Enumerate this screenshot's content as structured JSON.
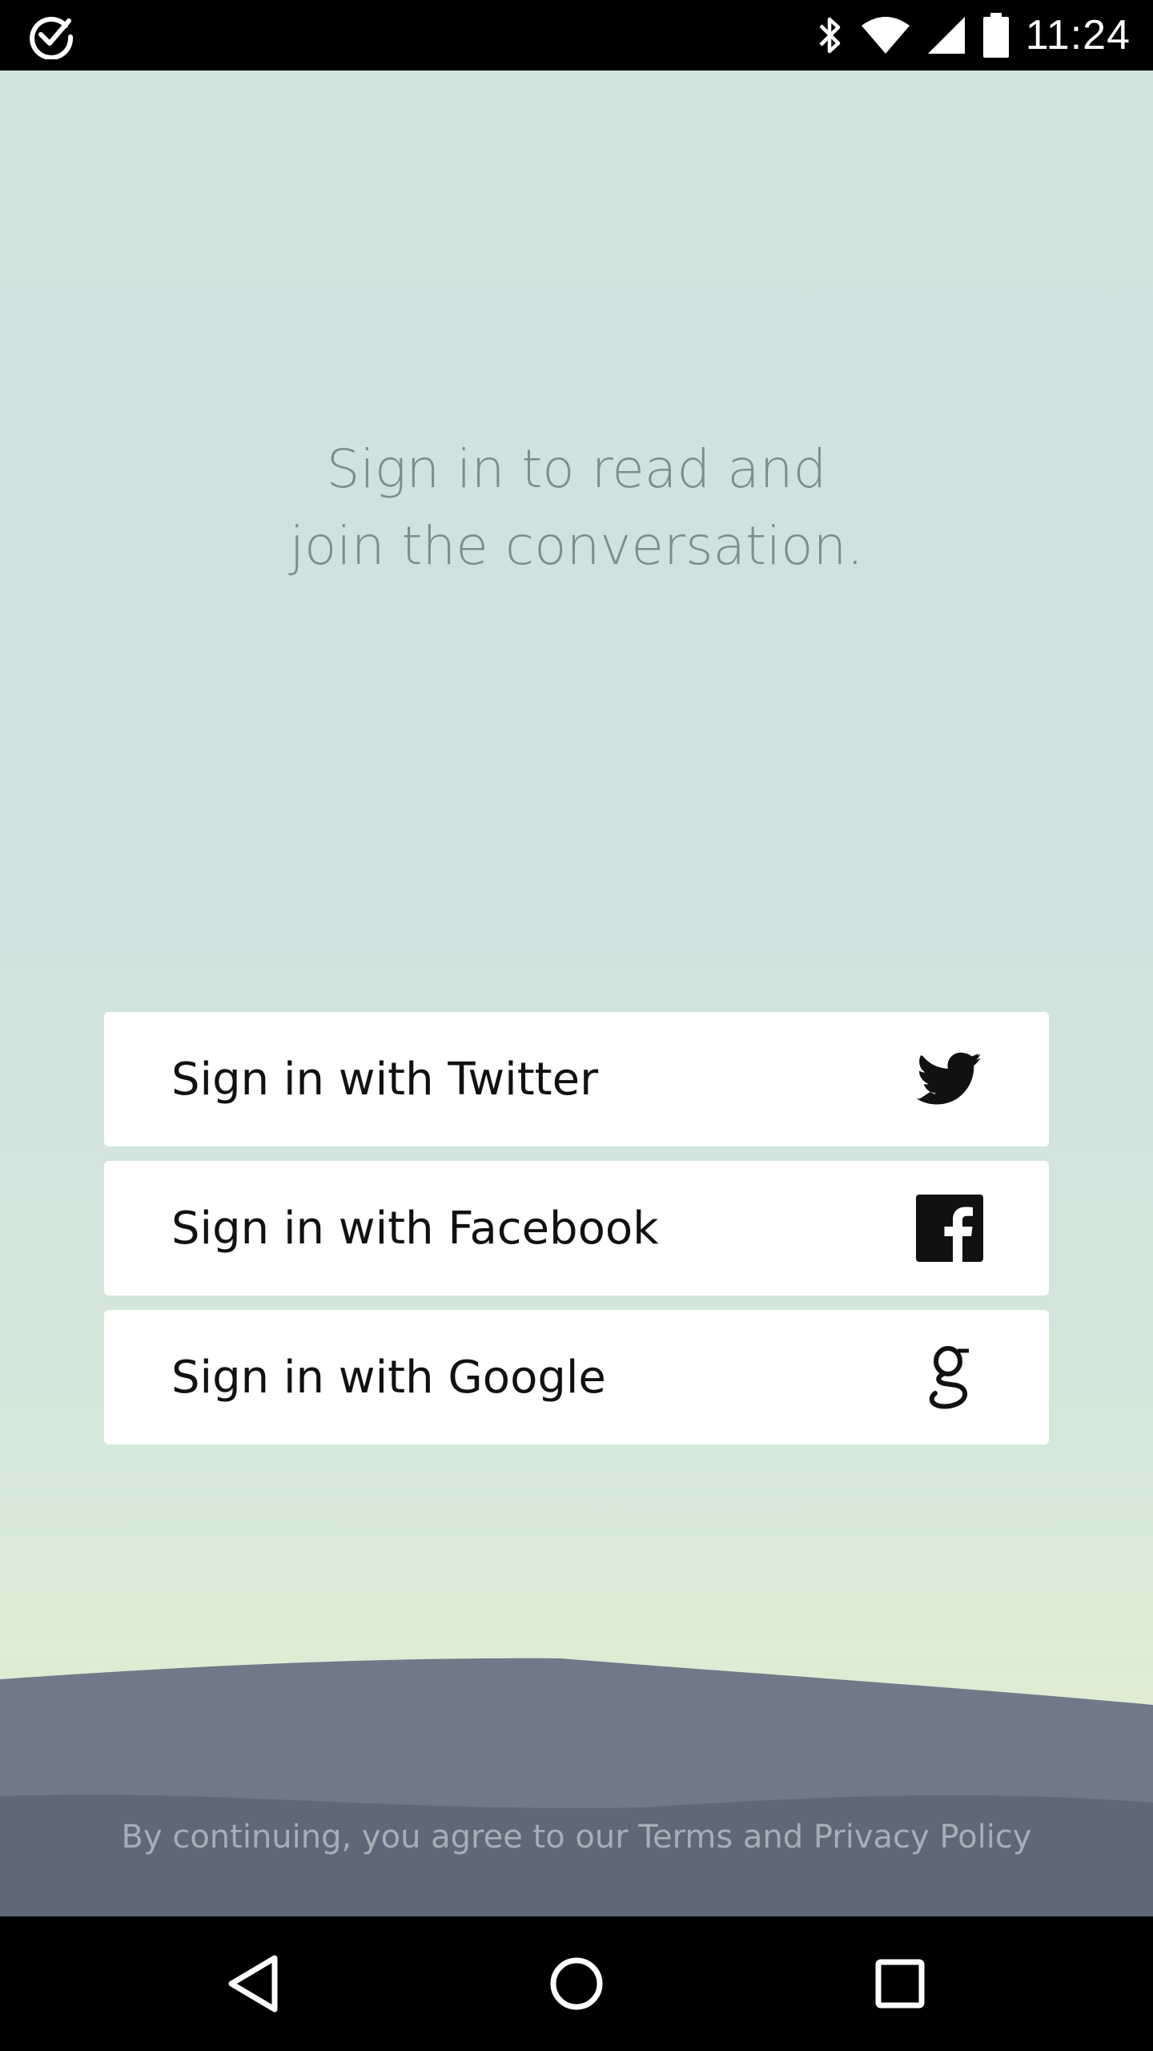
{
  "status_bar": {
    "time": "11:24",
    "icons": [
      "check-circle-icon",
      "bluetooth-icon",
      "wifi-icon",
      "signal-icon",
      "battery-icon"
    ]
  },
  "headline": {
    "line1": "Sign in to read and",
    "line2": "join the conversation."
  },
  "signin_buttons": [
    {
      "label": "Sign in with Twitter",
      "icon": "twitter-icon"
    },
    {
      "label": "Sign in with Facebook",
      "icon": "facebook-icon"
    },
    {
      "label": "Sign in with Google",
      "icon": "google-icon"
    }
  ],
  "legal": {
    "text": "By continuing, you agree to our Terms and Privacy Policy"
  },
  "nav_bar": {
    "icons": [
      "back-icon",
      "home-icon",
      "recents-icon"
    ]
  },
  "colors": {
    "background_top": "#d0e3df",
    "background_bottom": "#e4efcf",
    "hills_far": "#6e7a88",
    "hills_near": "#5f6877",
    "headline_text": "#7e8d8c",
    "button_bg": "#ffffff"
  }
}
